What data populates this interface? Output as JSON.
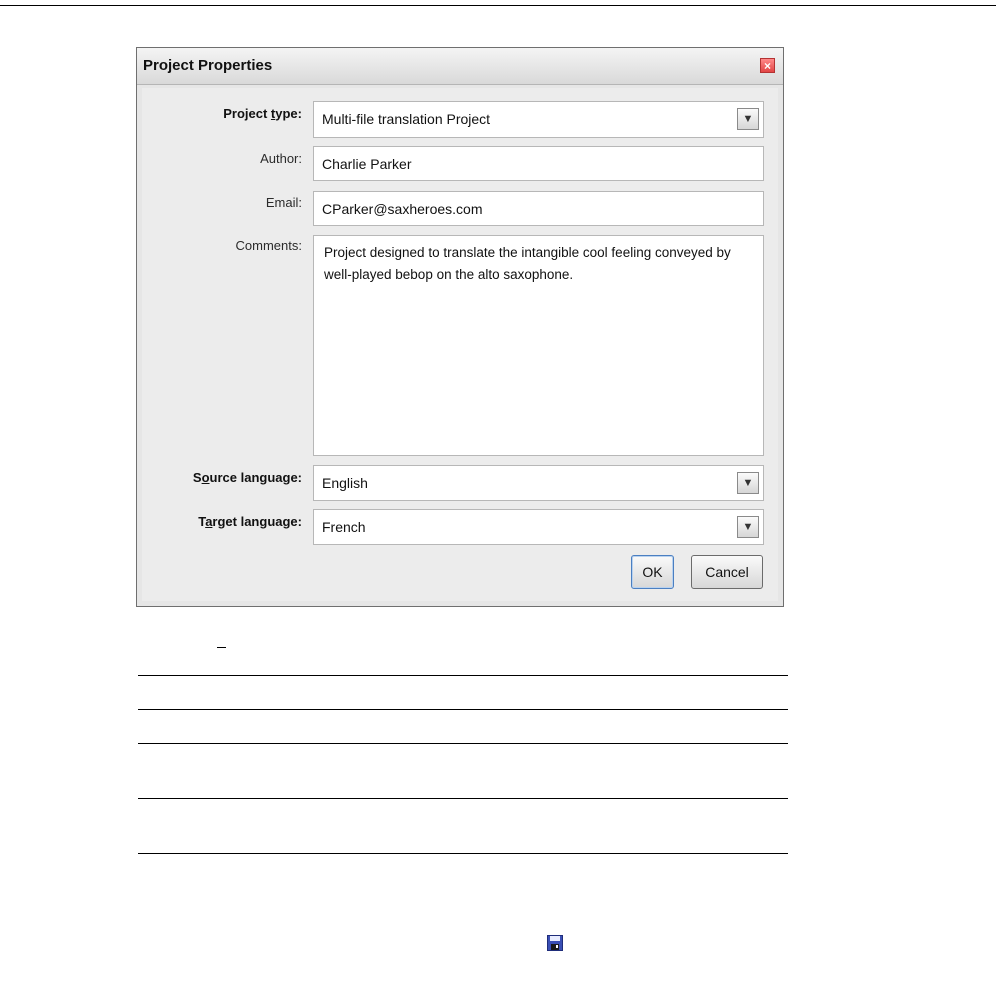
{
  "dialog": {
    "title": "Project Properties",
    "close_glyph": "×",
    "fields": {
      "project_type": {
        "label_pre": "Project ",
        "label_mnemonic": "t",
        "label_post": "ype:",
        "value": "Multi-file translation Project"
      },
      "author": {
        "label": "Author:",
        "value": "Charlie Parker"
      },
      "email": {
        "label": "Email:",
        "value": "CParker@saxheroes.com"
      },
      "comments": {
        "label": "Comments:",
        "value": "Project designed to translate the intangible cool feeling conveyed by well-played bebop on the alto saxophone."
      },
      "source_language": {
        "label_pre": "S",
        "label_mnemonic": "o",
        "label_post": "urce language:",
        "value": "English"
      },
      "target_language": {
        "label_pre": "T",
        "label_mnemonic": "a",
        "label_post": "rget language:",
        "value": "French"
      }
    },
    "buttons": {
      "ok": "OK",
      "cancel": "Cancel"
    },
    "combo_arrow_glyph": "▼"
  },
  "icons": {
    "footer_icon": "floppy-disk-icon"
  }
}
